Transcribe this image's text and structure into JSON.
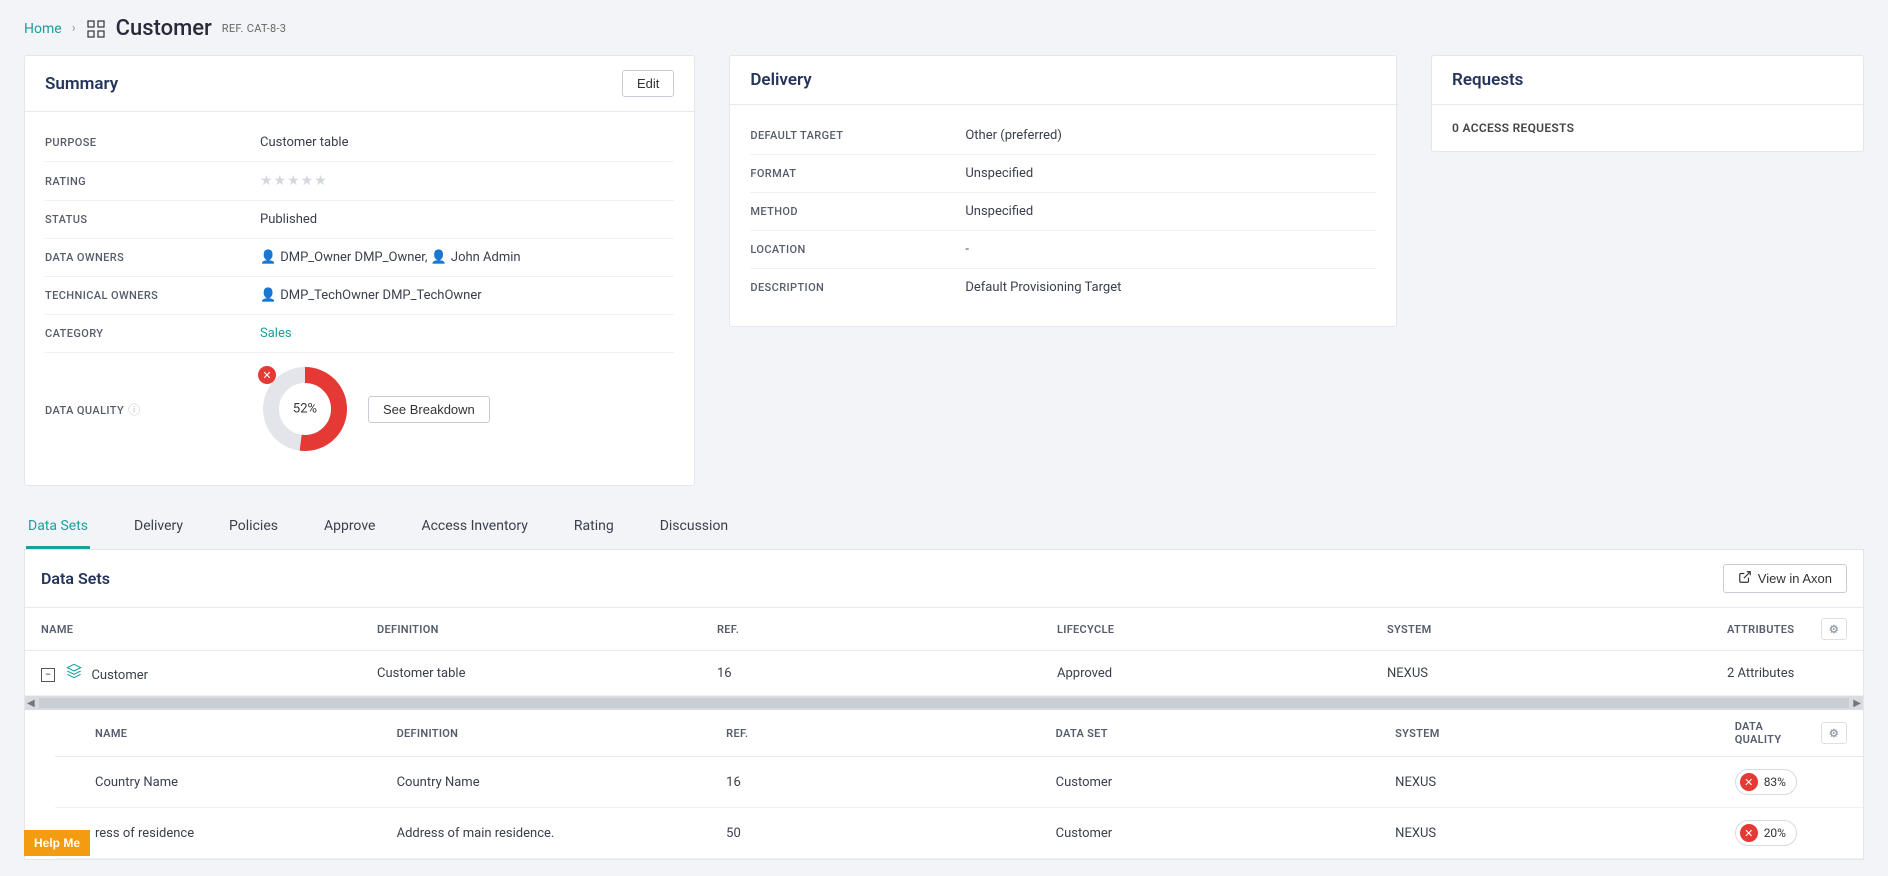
{
  "breadcrumb": {
    "home": "Home",
    "title": "Customer",
    "ref": "REF. CAT-8-3"
  },
  "summary": {
    "heading": "Summary",
    "edit": "Edit",
    "labels": {
      "purpose": "PURPOSE",
      "rating": "RATING",
      "status": "STATUS",
      "data_owners": "DATA OWNERS",
      "technical_owners": "TECHNICAL OWNERS",
      "category": "CATEGORY",
      "data_quality": "DATA QUALITY"
    },
    "values": {
      "purpose": "Customer table",
      "status": "Published",
      "data_owner_1": "DMP_Owner DMP_Owner,",
      "data_owner_2": "John Admin",
      "technical_owner": "DMP_TechOwner DMP_TechOwner",
      "category": "Sales"
    },
    "data_quality": {
      "percent_label": "52%",
      "percent": 52,
      "see_breakdown": "See Breakdown"
    }
  },
  "delivery": {
    "heading": "Delivery",
    "labels": {
      "default_target": "DEFAULT TARGET",
      "format": "FORMAT",
      "method": "METHOD",
      "location": "LOCATION",
      "description": "DESCRIPTION"
    },
    "values": {
      "default_target": "Other (preferred)",
      "format": "Unspecified",
      "method": "Unspecified",
      "location": "-",
      "description": "Default Provisioning Target"
    }
  },
  "requests": {
    "heading": "Requests",
    "value": "0 ACCESS REQUESTS"
  },
  "tabs": [
    "Data Sets",
    "Delivery",
    "Policies",
    "Approve",
    "Access Inventory",
    "Rating",
    "Discussion"
  ],
  "datasets": {
    "heading": "Data Sets",
    "view_in_axon": "View in Axon",
    "columns": {
      "name": "NAME",
      "definition": "DEFINITION",
      "ref": "REF.",
      "lifecycle": "LIFECYCLE",
      "system": "SYSTEM",
      "attributes": "ATTRIBUTES"
    },
    "row": {
      "name": "Customer",
      "definition": "Customer table",
      "ref": "16",
      "lifecycle": "Approved",
      "system": "NEXUS",
      "attributes": "2 Attributes"
    },
    "inner_columns": {
      "name": "NAME",
      "definition": "DEFINITION",
      "ref": "REF.",
      "data_set": "DATA SET",
      "system": "SYSTEM",
      "data_quality": "DATA QUALITY"
    },
    "inner_rows": [
      {
        "name": "Country Name",
        "definition": "Country Name",
        "ref": "16",
        "data_set": "Customer",
        "system": "NEXUS",
        "dq": "83%"
      },
      {
        "name": "ress of residence",
        "definition": "Address of main residence.",
        "ref": "50",
        "data_set": "Customer",
        "system": "NEXUS",
        "dq": "20%"
      }
    ]
  },
  "help": "Help Me"
}
